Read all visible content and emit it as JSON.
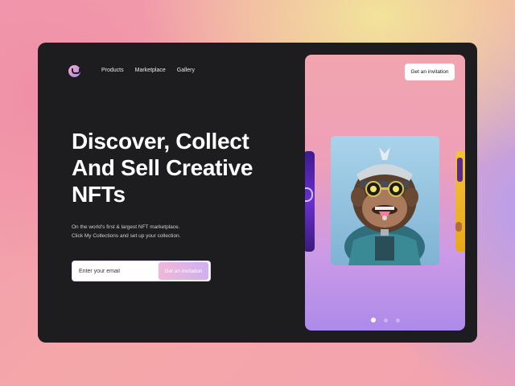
{
  "nav": {
    "items": [
      "Products",
      "Marketplace",
      "Gallery"
    ]
  },
  "hero": {
    "headline_lines": [
      "Discover, Collect",
      "And Sell Creative",
      "NFTs"
    ],
    "subtitle_lines": [
      "On the world's first & largest NFT marketplace.",
      "Click My Collections and set up your collection."
    ]
  },
  "email_form": {
    "placeholder": "Enter your email",
    "button_label": "Get an invitation"
  },
  "showcase": {
    "invite_button_label": "Get an invitation",
    "carousel_dots": 3,
    "active_dot": 0,
    "image_icon": "ape-nft-artwork-icon"
  },
  "colors": {
    "card_bg": "#1d1d1f",
    "accent_pink": "#f1b7d8",
    "accent_purple": "#b08ae8"
  }
}
